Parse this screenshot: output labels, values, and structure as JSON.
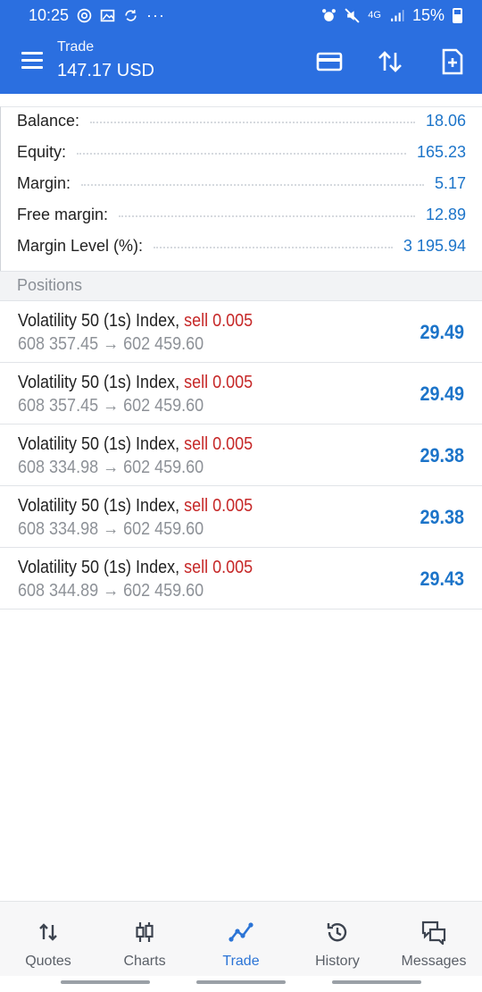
{
  "status_bar": {
    "time": "10:25",
    "dots": "···",
    "network": "4G",
    "battery": "15%"
  },
  "app_bar": {
    "title": "Trade",
    "subtitle": "147.17 USD"
  },
  "summary": [
    {
      "label": "Balance:",
      "value": "18.06"
    },
    {
      "label": "Equity:",
      "value": "165.23"
    },
    {
      "label": "Margin:",
      "value": "5.17"
    },
    {
      "label": "Free margin:",
      "value": "12.89"
    },
    {
      "label": "Margin Level (%):",
      "value": "3 195.94"
    }
  ],
  "positions_header": "Positions",
  "positions": [
    {
      "symbol": "Volatility 50 (1s) Index,",
      "side": "sell 0.005",
      "prices": "608 357.45 → 602 459.60",
      "profit": "29.49"
    },
    {
      "symbol": "Volatility 50 (1s) Index,",
      "side": "sell 0.005",
      "prices": "608 357.45 → 602 459.60",
      "profit": "29.49"
    },
    {
      "symbol": "Volatility 50 (1s) Index,",
      "side": "sell 0.005",
      "prices": "608 334.98 → 602 459.60",
      "profit": "29.38"
    },
    {
      "symbol": "Volatility 50 (1s) Index,",
      "side": "sell 0.005",
      "prices": "608 334.98 → 602 459.60",
      "profit": "29.38"
    },
    {
      "symbol": "Volatility 50 (1s) Index,",
      "side": "sell 0.005",
      "prices": "608 344.89 → 602 459.60",
      "profit": "29.43"
    }
  ],
  "tabs": [
    {
      "label": "Quotes",
      "icon": "quotes-icon"
    },
    {
      "label": "Charts",
      "icon": "charts-icon"
    },
    {
      "label": "Trade",
      "icon": "trade-icon",
      "active": true
    },
    {
      "label": "History",
      "icon": "history-icon"
    },
    {
      "label": "Messages",
      "icon": "messages-icon"
    }
  ],
  "colors": {
    "brand": "#2b6fe0",
    "value_blue": "#1c74c9",
    "sell_red": "#c62828",
    "muted": "#8d9197"
  }
}
